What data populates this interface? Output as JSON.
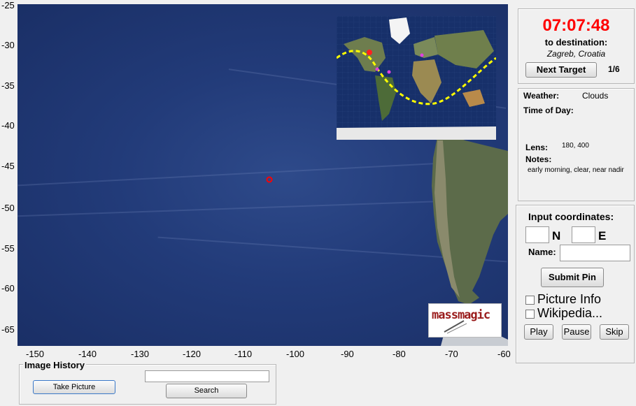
{
  "map": {
    "y_ticks": [
      "-25",
      "-30",
      "-35",
      "-40",
      "-45",
      "-50",
      "-55",
      "-60",
      "-65"
    ],
    "x_ticks": [
      "-150",
      "-140",
      "-130",
      "-120",
      "-110",
      "-100",
      "-90",
      "-80",
      "-70",
      "-60"
    ],
    "logo_text": "massmagic"
  },
  "timer": {
    "time": "07:07:48",
    "to_destination_label": "to destination:",
    "destination": "Zagreb, Croatia",
    "next_target_label": "Next Target",
    "progress": "1/6"
  },
  "info": {
    "weather_label": "Weather:",
    "weather_value": "Clouds",
    "time_of_day_label": "Time of Day:",
    "lens_label": "Lens:",
    "lens_value": "180, 400",
    "notes_label": "Notes:",
    "notes_value": "early morning, clear, near nadir"
  },
  "coords": {
    "title": "Input coordinates:",
    "n_label": "N",
    "e_label": "E",
    "name_label": "Name:",
    "submit_label": "Submit Pin",
    "picture_info_label": "Picture Info",
    "wikipedia_label": "Wikipedia...",
    "play_label": "Play",
    "pause_label": "Pause",
    "skip_label": "Skip"
  },
  "history": {
    "title": "Image History",
    "take_picture_label": "Take Picture",
    "search_label": "Search"
  },
  "colors": {
    "timer_red": "#ff0000",
    "path_yellow": "#ffff00",
    "marker_magenta": "#e040e0"
  }
}
